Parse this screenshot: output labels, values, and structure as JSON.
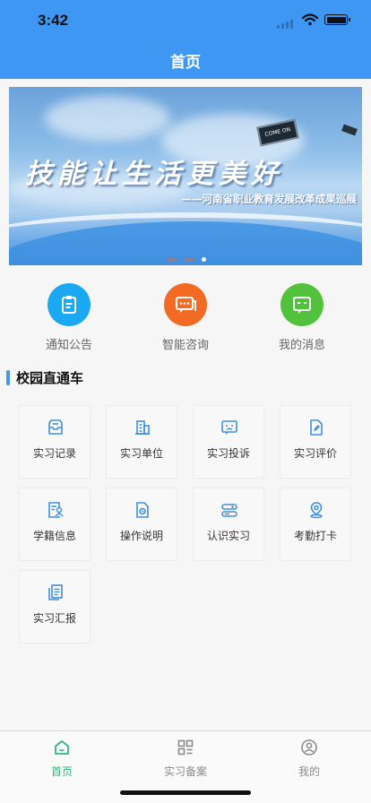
{
  "status_bar": {
    "time": "3:42"
  },
  "header": {
    "title": "首页"
  },
  "banner": {
    "slogan": "技能让生活更美好",
    "subtitle": "——河南省职业教育发展改革成果巡展",
    "sign_text": "COME ON",
    "slide_count": 3,
    "active_slide": 3
  },
  "quick_actions": [
    {
      "label": "通知公告",
      "icon": "notice-icon",
      "color": "#1ba8f2"
    },
    {
      "label": "智能咨询",
      "icon": "chat-icon",
      "color": "#f26a24"
    },
    {
      "label": "我的消息",
      "icon": "message-icon",
      "color": "#52c23c"
    }
  ],
  "section": {
    "title": "校园直通车"
  },
  "grid": [
    {
      "label": "实习记录",
      "icon": "inbox-icon"
    },
    {
      "label": "实习单位",
      "icon": "building-icon"
    },
    {
      "label": "实习投诉",
      "icon": "complaint-icon"
    },
    {
      "label": "实习评价",
      "icon": "edit-icon"
    },
    {
      "label": "学籍信息",
      "icon": "student-id-icon"
    },
    {
      "label": "操作说明",
      "icon": "gear-document-icon"
    },
    {
      "label": "认识实习",
      "icon": "toggle-icon"
    },
    {
      "label": "考勤打卡",
      "icon": "location-pin-icon"
    },
    {
      "label": "实习汇报",
      "icon": "report-icon"
    }
  ],
  "tabbar": {
    "items": [
      {
        "label": "首页",
        "icon": "home-icon",
        "active": true
      },
      {
        "label": "实习备案",
        "icon": "grid-icon",
        "active": false
      },
      {
        "label": "我的",
        "icon": "user-icon",
        "active": false
      }
    ],
    "active_color": "#2db87d"
  },
  "colors": {
    "primary": "#3f97f4",
    "icon_accent": "#3f8fe0"
  }
}
